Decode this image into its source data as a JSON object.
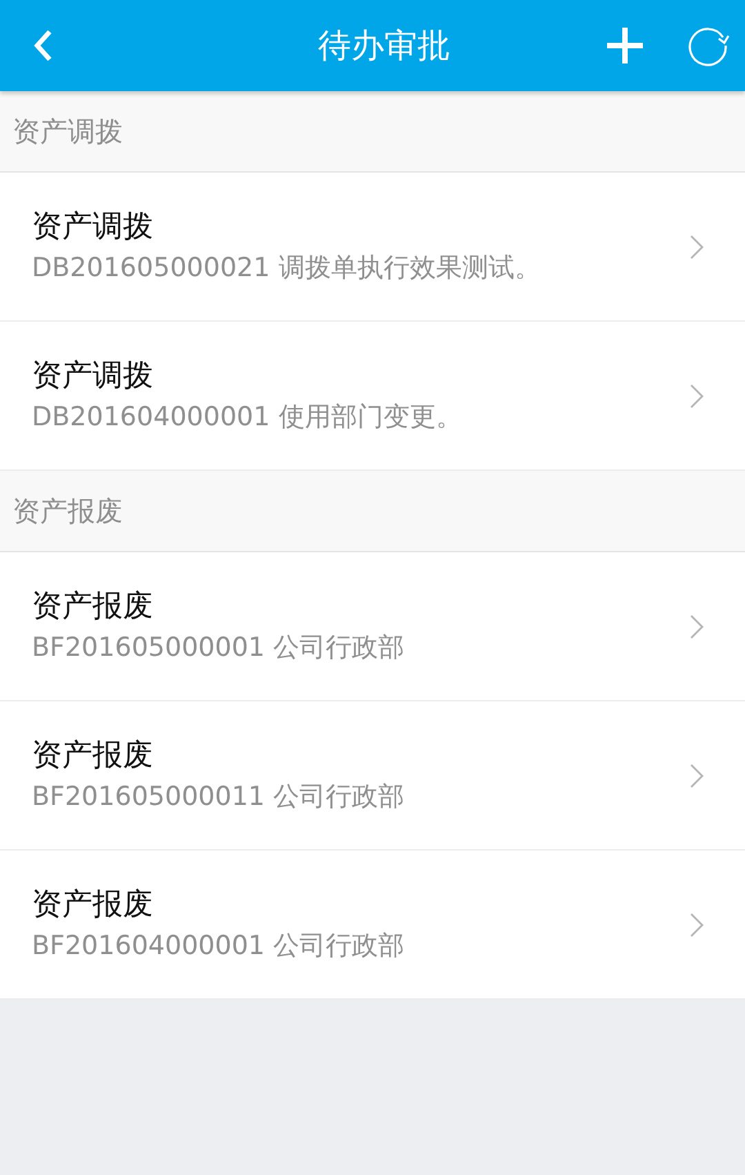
{
  "header": {
    "title": "待办审批"
  },
  "sections": [
    {
      "title": "资产调拨",
      "items": [
        {
          "title": "资产调拨",
          "subtitle": "DB201605000021 调拨单执行效果测试。"
        },
        {
          "title": "资产调拨",
          "subtitle": "DB201604000001 使用部门变更。"
        }
      ]
    },
    {
      "title": "资产报废",
      "items": [
        {
          "title": "资产报废",
          "subtitle": "BF201605000001 公司行政部"
        },
        {
          "title": "资产报废",
          "subtitle": "BF201605000011 公司行政部"
        },
        {
          "title": "资产报废",
          "subtitle": "BF201604000001 公司行政部"
        }
      ]
    }
  ]
}
